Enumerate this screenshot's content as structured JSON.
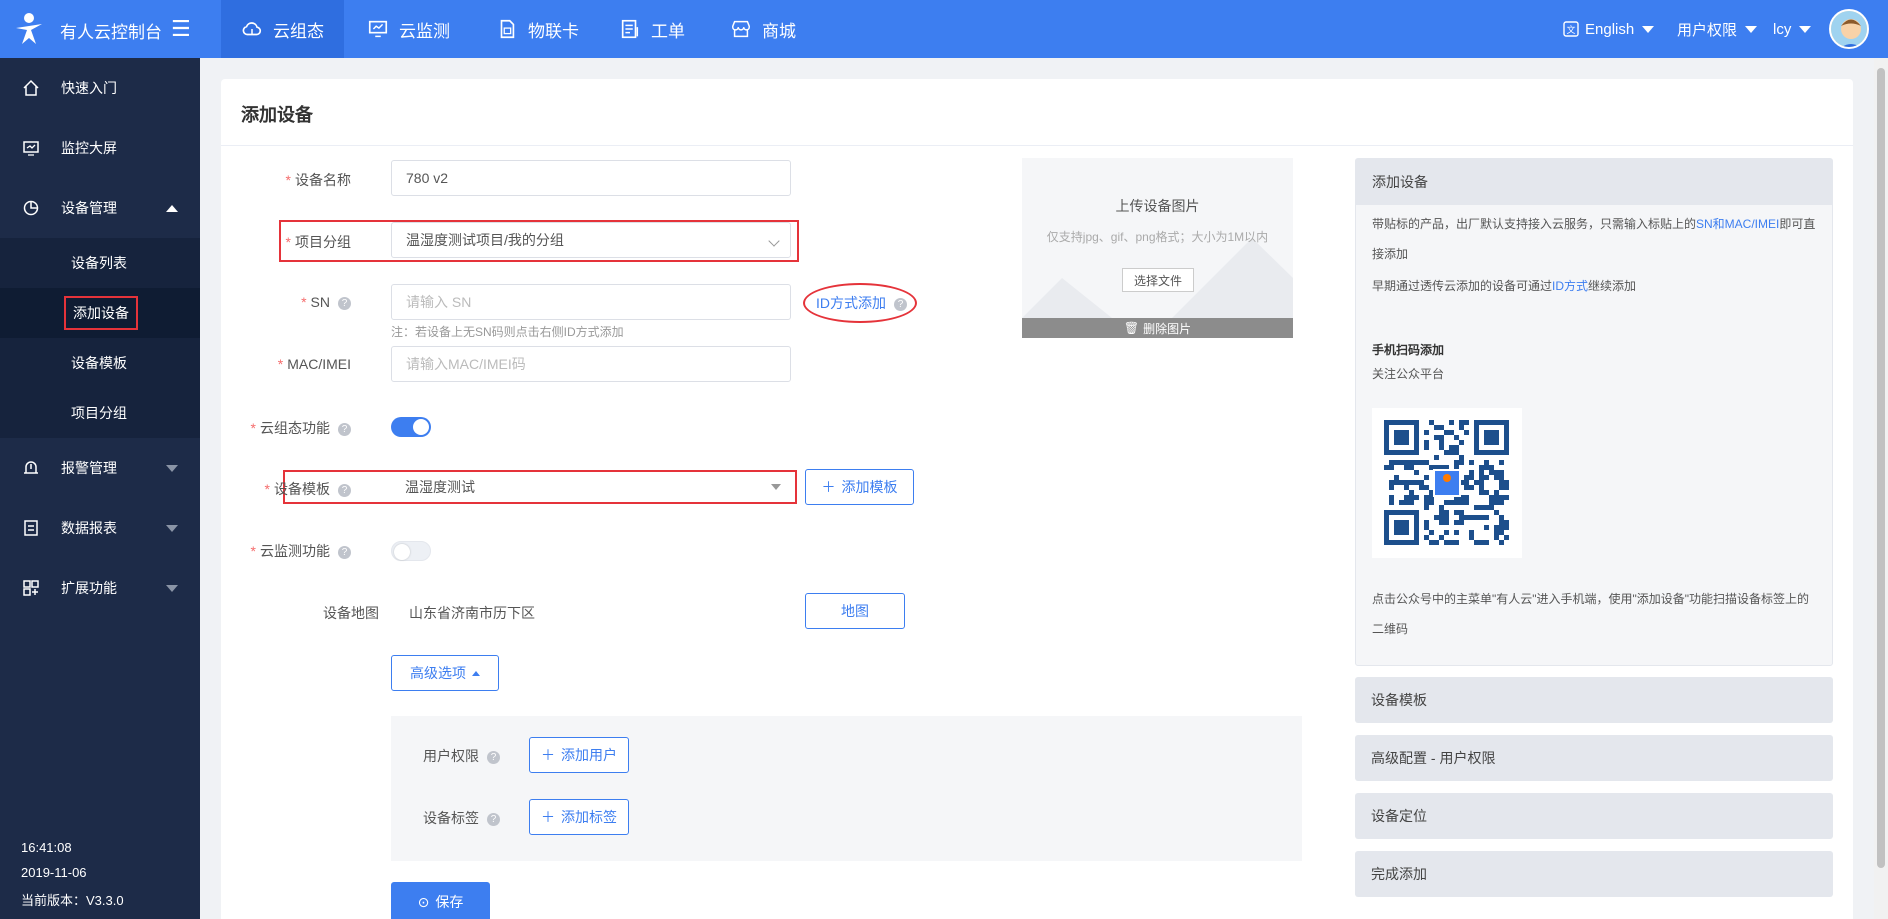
{
  "topbar": {
    "brand": "有人云控制台",
    "tabs": [
      {
        "label": "云组态",
        "icon": "cloud-icon",
        "active": true
      },
      {
        "label": "云监测",
        "icon": "monitor-icon"
      },
      {
        "label": "物联卡",
        "icon": "sim-card-icon"
      },
      {
        "label": "工单",
        "icon": "work-order-icon"
      },
      {
        "label": "商城",
        "icon": "store-icon"
      }
    ],
    "language": "English",
    "permissions": "用户权限",
    "user": "lcy"
  },
  "sidebar": {
    "items": [
      {
        "label": "快速入门",
        "icon": "home-icon"
      },
      {
        "label": "监控大屏",
        "icon": "screen-icon"
      },
      {
        "label": "设备管理",
        "icon": "device-management-icon"
      },
      {
        "label": "报警管理",
        "icon": "alarm-icon"
      },
      {
        "label": "数据报表",
        "icon": "report-icon"
      },
      {
        "label": "扩展功能",
        "icon": "extension-icon"
      }
    ],
    "subitems": [
      "设备列表",
      "添加设备",
      "设备模板",
      "项目分组"
    ],
    "time": "16:41:08",
    "date": "2019-11-06",
    "version": "当前版本：V3.3.0"
  },
  "page": {
    "title": "添加设备"
  },
  "form": {
    "device_name_label": "设备名称",
    "device_name_value": "780 v2",
    "project_group_label": "项目分组",
    "project_group_value": "温湿度测试项目/我的分组",
    "sn_label": "SN",
    "sn_placeholder": "请输入 SN",
    "sn_note": "注：若设备上无SN码则点击右侧ID方式添加",
    "id_add_link": "ID方式添加",
    "mac_label": "MAC/IMEI",
    "mac_placeholder": "请输入MAC/IMEI码",
    "cloud_config_label": "云组态功能",
    "template_label": "设备模板",
    "template_value": "温湿度测试",
    "add_template_button": "添加模板",
    "cloud_monitor_label": "云监测功能",
    "map_label": "设备地图",
    "map_value": "山东省济南市历下区",
    "map_button": "地图",
    "advanced_button": "高级选项",
    "user_perm_label": "用户权限",
    "add_user_button": "添加用户",
    "device_tag_label": "设备标签",
    "add_tag_button": "添加标签",
    "save_button": "保存"
  },
  "upload": {
    "title": "上传设备图片",
    "hint": "仅支持jpg、gif、png格式；大小为1M以内",
    "choose_button": "选择文件",
    "delete_button": "删除图片"
  },
  "help": {
    "header": "添加设备",
    "p1_prefix": "带贴标的产品，出厂默认支持接入云服务，只需输入标贴上的",
    "p1_link": "SN和MAC/IMEI",
    "p1_suffix": "即可直接添加",
    "p2_prefix": "早期通过透传云添加的设备可通过",
    "p2_link": "ID方式",
    "p2_suffix": "继续添加",
    "scan_title": "手机扫码添加",
    "follow": "关注公众平台",
    "qr_caption": "点击公众号中的主菜单\"有人云\"进入手机端，使用\"添加设备\"功能扫描设备标签上的二维码",
    "sections": [
      "设备模板",
      "高级配置 - 用户权限",
      "设备定位",
      "完成添加"
    ]
  },
  "colors": {
    "primary": "#3d7ef0",
    "sidebar": "#1d2b48",
    "highlight": "#e5333a"
  }
}
